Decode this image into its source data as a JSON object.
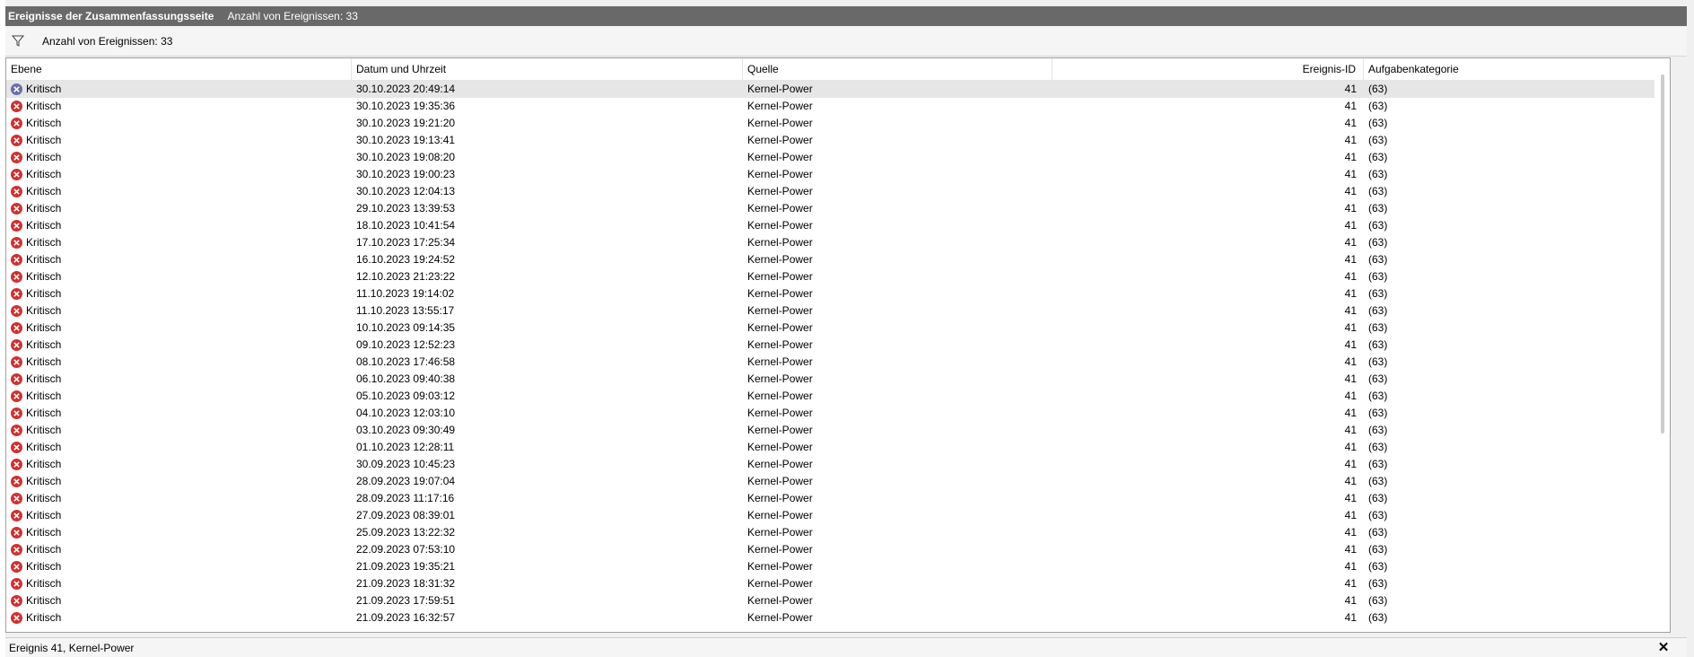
{
  "title_bar": {
    "title": "Ereignisse der Zusammenfassungsseite",
    "count_label": "Anzahl von Ereignissen: 33"
  },
  "filter_bar": {
    "icon": "filter-icon",
    "text": "Anzahl von Ereignissen: 33"
  },
  "table": {
    "columns": [
      "Ebene",
      "Datum und Uhrzeit",
      "Quelle",
      "Ereignis-ID",
      "Aufgabenkategorie"
    ],
    "rows": [
      {
        "level": "Kritisch",
        "datetime": "30.10.2023 20:49:14",
        "source": "Kernel-Power",
        "event_id": "41",
        "category": "(63)"
      },
      {
        "level": "Kritisch",
        "datetime": "30.10.2023 19:35:36",
        "source": "Kernel-Power",
        "event_id": "41",
        "category": "(63)"
      },
      {
        "level": "Kritisch",
        "datetime": "30.10.2023 19:21:20",
        "source": "Kernel-Power",
        "event_id": "41",
        "category": "(63)"
      },
      {
        "level": "Kritisch",
        "datetime": "30.10.2023 19:13:41",
        "source": "Kernel-Power",
        "event_id": "41",
        "category": "(63)"
      },
      {
        "level": "Kritisch",
        "datetime": "30.10.2023 19:08:20",
        "source": "Kernel-Power",
        "event_id": "41",
        "category": "(63)"
      },
      {
        "level": "Kritisch",
        "datetime": "30.10.2023 19:00:23",
        "source": "Kernel-Power",
        "event_id": "41",
        "category": "(63)"
      },
      {
        "level": "Kritisch",
        "datetime": "30.10.2023 12:04:13",
        "source": "Kernel-Power",
        "event_id": "41",
        "category": "(63)"
      },
      {
        "level": "Kritisch",
        "datetime": "29.10.2023 13:39:53",
        "source": "Kernel-Power",
        "event_id": "41",
        "category": "(63)"
      },
      {
        "level": "Kritisch",
        "datetime": "18.10.2023 10:41:54",
        "source": "Kernel-Power",
        "event_id": "41",
        "category": "(63)"
      },
      {
        "level": "Kritisch",
        "datetime": "17.10.2023 17:25:34",
        "source": "Kernel-Power",
        "event_id": "41",
        "category": "(63)"
      },
      {
        "level": "Kritisch",
        "datetime": "16.10.2023 19:24:52",
        "source": "Kernel-Power",
        "event_id": "41",
        "category": "(63)"
      },
      {
        "level": "Kritisch",
        "datetime": "12.10.2023 21:23:22",
        "source": "Kernel-Power",
        "event_id": "41",
        "category": "(63)"
      },
      {
        "level": "Kritisch",
        "datetime": "11.10.2023 19:14:02",
        "source": "Kernel-Power",
        "event_id": "41",
        "category": "(63)"
      },
      {
        "level": "Kritisch",
        "datetime": "11.10.2023 13:55:17",
        "source": "Kernel-Power",
        "event_id": "41",
        "category": "(63)"
      },
      {
        "level": "Kritisch",
        "datetime": "10.10.2023 09:14:35",
        "source": "Kernel-Power",
        "event_id": "41",
        "category": "(63)"
      },
      {
        "level": "Kritisch",
        "datetime": "09.10.2023 12:52:23",
        "source": "Kernel-Power",
        "event_id": "41",
        "category": "(63)"
      },
      {
        "level": "Kritisch",
        "datetime": "08.10.2023 17:46:58",
        "source": "Kernel-Power",
        "event_id": "41",
        "category": "(63)"
      },
      {
        "level": "Kritisch",
        "datetime": "06.10.2023 09:40:38",
        "source": "Kernel-Power",
        "event_id": "41",
        "category": "(63)"
      },
      {
        "level": "Kritisch",
        "datetime": "05.10.2023 09:03:12",
        "source": "Kernel-Power",
        "event_id": "41",
        "category": "(63)"
      },
      {
        "level": "Kritisch",
        "datetime": "04.10.2023 12:03:10",
        "source": "Kernel-Power",
        "event_id": "41",
        "category": "(63)"
      },
      {
        "level": "Kritisch",
        "datetime": "03.10.2023 09:30:49",
        "source": "Kernel-Power",
        "event_id": "41",
        "category": "(63)"
      },
      {
        "level": "Kritisch",
        "datetime": "01.10.2023 12:28:11",
        "source": "Kernel-Power",
        "event_id": "41",
        "category": "(63)"
      },
      {
        "level": "Kritisch",
        "datetime": "30.09.2023 10:45:23",
        "source": "Kernel-Power",
        "event_id": "41",
        "category": "(63)"
      },
      {
        "level": "Kritisch",
        "datetime": "28.09.2023 19:07:04",
        "source": "Kernel-Power",
        "event_id": "41",
        "category": "(63)"
      },
      {
        "level": "Kritisch",
        "datetime": "28.09.2023 11:17:16",
        "source": "Kernel-Power",
        "event_id": "41",
        "category": "(63)"
      },
      {
        "level": "Kritisch",
        "datetime": "27.09.2023 08:39:01",
        "source": "Kernel-Power",
        "event_id": "41",
        "category": "(63)"
      },
      {
        "level": "Kritisch",
        "datetime": "25.09.2023 13:22:32",
        "source": "Kernel-Power",
        "event_id": "41",
        "category": "(63)"
      },
      {
        "level": "Kritisch",
        "datetime": "22.09.2023 07:53:10",
        "source": "Kernel-Power",
        "event_id": "41",
        "category": "(63)"
      },
      {
        "level": "Kritisch",
        "datetime": "21.09.2023 19:35:21",
        "source": "Kernel-Power",
        "event_id": "41",
        "category": "(63)"
      },
      {
        "level": "Kritisch",
        "datetime": "21.09.2023 18:31:32",
        "source": "Kernel-Power",
        "event_id": "41",
        "category": "(63)"
      },
      {
        "level": "Kritisch",
        "datetime": "21.09.2023 17:59:51",
        "source": "Kernel-Power",
        "event_id": "41",
        "category": "(63)"
      },
      {
        "level": "Kritisch",
        "datetime": "21.09.2023 16:32:57",
        "source": "Kernel-Power",
        "event_id": "41",
        "category": "(63)"
      }
    ],
    "level_icon": "critical-error-icon",
    "selected_index": 0
  },
  "status_bar": {
    "text": "Ereignis 41, Kernel-Power",
    "close_label": "✕"
  },
  "colors": {
    "title_bar_bg": "#696969",
    "error_icon": "#d32f2f",
    "selected_row": "#e6e6e6"
  }
}
